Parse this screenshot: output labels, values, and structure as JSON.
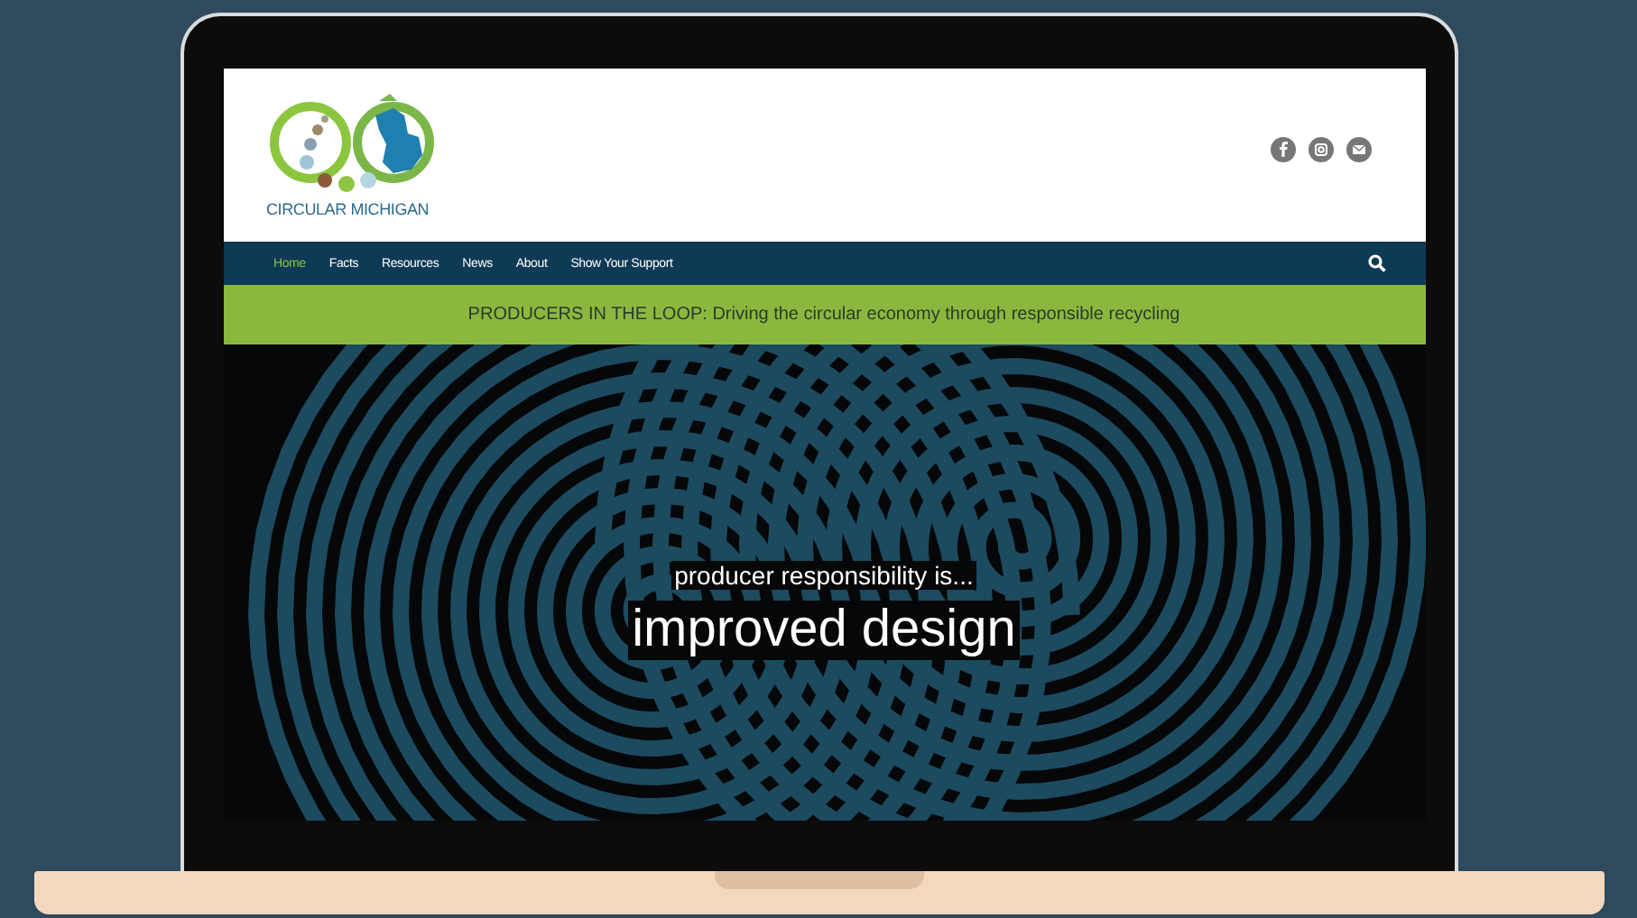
{
  "site": {
    "logo_text": "CIRCULAR MICHIGAN"
  },
  "nav": {
    "items": [
      {
        "label": "Home",
        "selected": true
      },
      {
        "label": "Facts",
        "selected": false
      },
      {
        "label": "Resources",
        "selected": false
      },
      {
        "label": "News",
        "selected": false
      },
      {
        "label": "About",
        "selected": false
      },
      {
        "label": "Show Your Support",
        "selected": false
      }
    ]
  },
  "banner": {
    "text": "PRODUCERS IN THE LOOP: Driving the circular economy through responsible recycling"
  },
  "hero": {
    "subtitle": "producer responsibility is...",
    "title": "improved design"
  }
}
